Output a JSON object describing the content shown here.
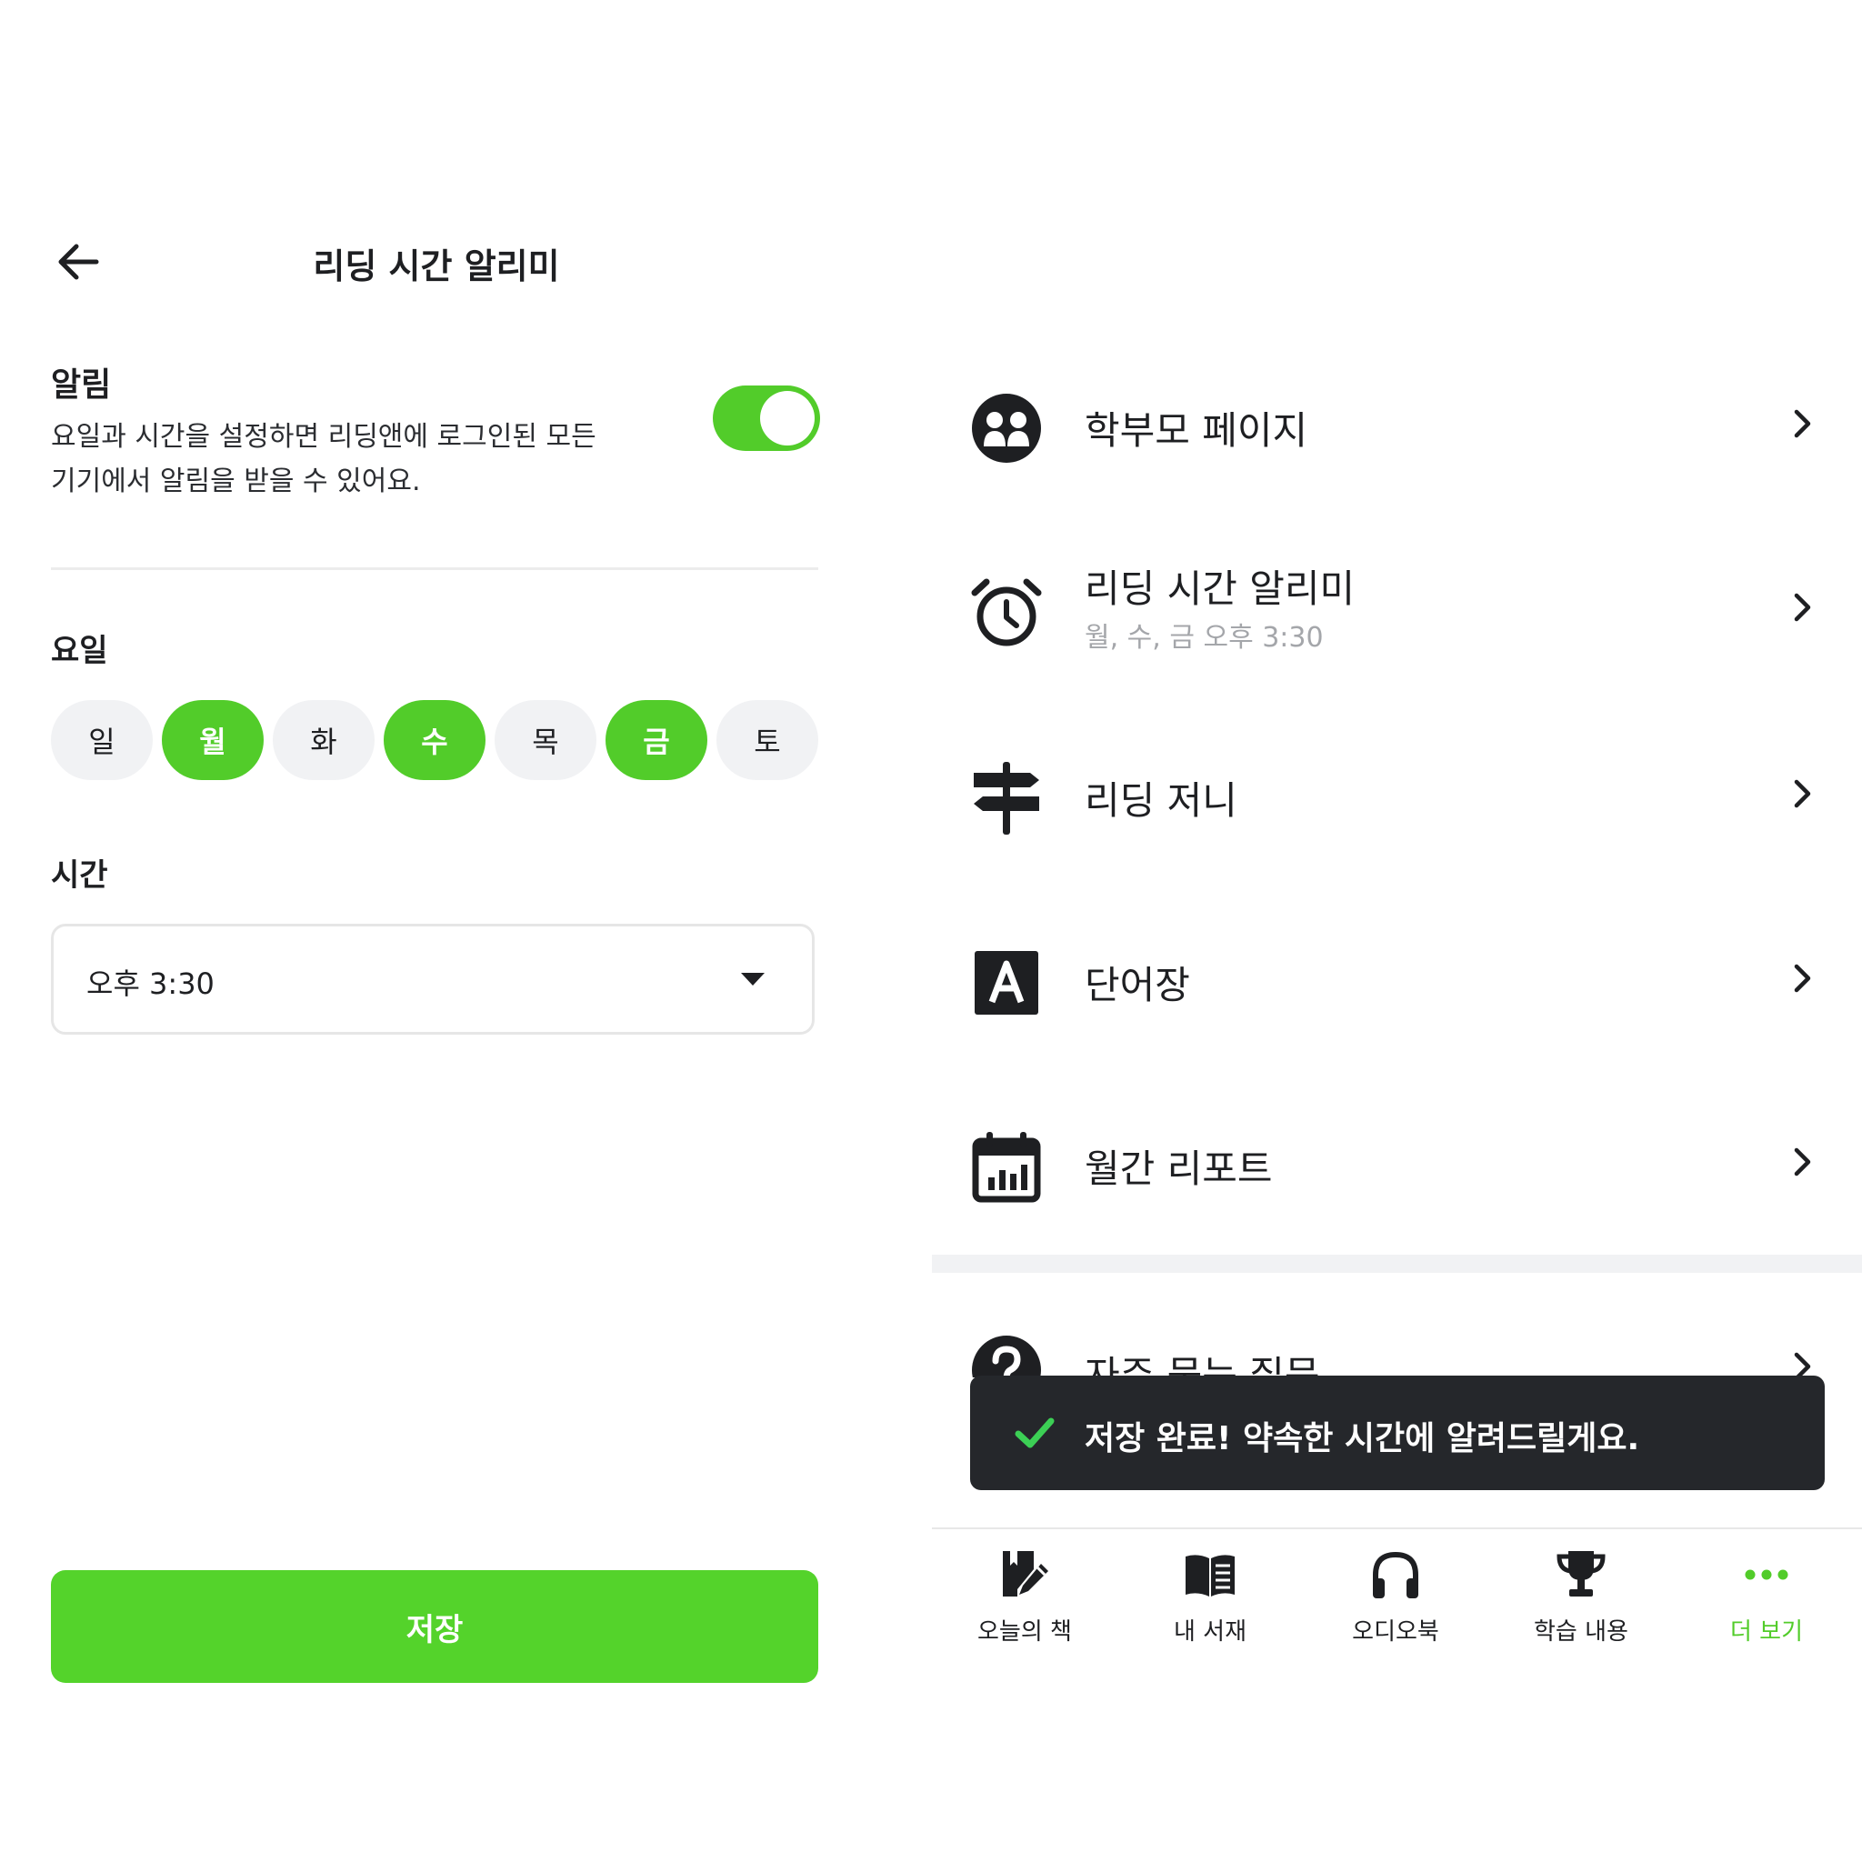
{
  "left_screen": {
    "header": {
      "title": "리딩 시간 알리미",
      "back_icon": "arrow-left-icon"
    },
    "alarm": {
      "label": "알림",
      "description_line1": "요일과 시간을 설정하면 리딩앤에 로그인된 모든",
      "description_line2": "기기에서 알림을 받을 수 있어요.",
      "toggle_on": true
    },
    "days": {
      "label": "요일",
      "items": [
        {
          "label": "일",
          "selected": false
        },
        {
          "label": "월",
          "selected": true
        },
        {
          "label": "화",
          "selected": false
        },
        {
          "label": "수",
          "selected": true
        },
        {
          "label": "목",
          "selected": false
        },
        {
          "label": "금",
          "selected": true
        },
        {
          "label": "토",
          "selected": false
        }
      ]
    },
    "time": {
      "label": "시간",
      "value": "오후 3:30",
      "caret_icon": "caret-down-icon"
    },
    "save_label": "저장"
  },
  "right_screen": {
    "menu": [
      {
        "title": "학부모 페이지",
        "icon": "parents-icon"
      },
      {
        "title": "리딩 시간 알리미",
        "subtitle": "월, 수, 금 오후 3:30",
        "icon": "alarm-clock-icon"
      },
      {
        "title": "리딩 저니",
        "icon": "signpost-icon"
      },
      {
        "title": "단어장",
        "icon": "vocabulary-icon"
      },
      {
        "title": "월간 리포트",
        "icon": "calendar-chart-icon"
      },
      {
        "title": "자주 묻는 질문",
        "icon": "question-icon"
      }
    ],
    "toast": {
      "message": "저장 완료! 약속한 시간에 알려드릴게요.",
      "icon": "check-icon"
    },
    "bottom_nav": [
      {
        "label": "오늘의 책",
        "icon": "book-edit-icon",
        "active": false
      },
      {
        "label": "내 서재",
        "icon": "open-book-icon",
        "active": false
      },
      {
        "label": "오디오북",
        "icon": "headphones-icon",
        "active": false
      },
      {
        "label": "학습 내용",
        "icon": "trophy-icon",
        "active": false
      },
      {
        "label": "더 보기",
        "icon": "more-dots-icon",
        "active": true
      }
    ]
  },
  "colors": {
    "accent": "#52cc2a",
    "text": "#1e1f22",
    "muted": "#a4a6aa",
    "pill_bg": "#f1f2f4",
    "toast_bg": "#25272b",
    "check": "#3ccf55"
  }
}
